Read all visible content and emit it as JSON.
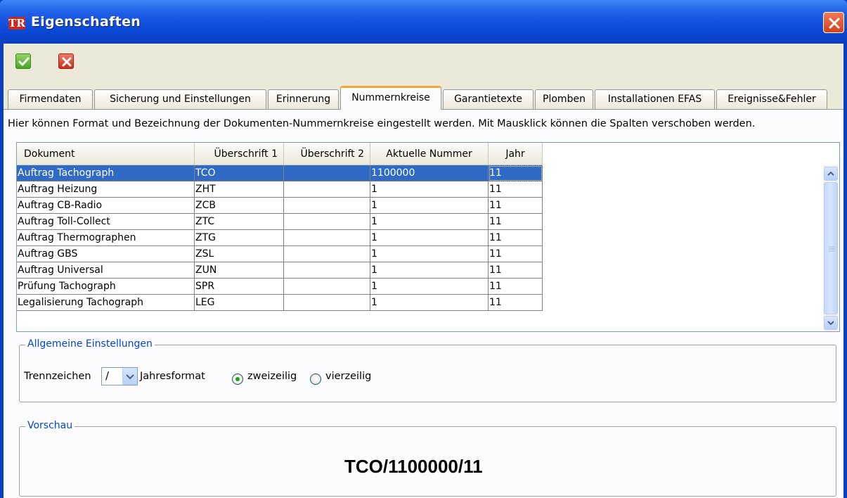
{
  "window": {
    "title": "Eigenschaften",
    "app_icon": "TR"
  },
  "toolbar": {
    "ok_icon": "check-icon",
    "cancel_icon": "x-icon"
  },
  "tabs": [
    {
      "label": "Firmendaten"
    },
    {
      "label": "Sicherung und Einstellungen"
    },
    {
      "label": "Erinnerung"
    },
    {
      "label": "Nummernkreise"
    },
    {
      "label": "Garantietexte"
    },
    {
      "label": "Plomben"
    },
    {
      "label": "Installationen EFAS"
    },
    {
      "label": "Ereignisse&Fehler"
    }
  ],
  "active_tab": "Nummernkreise",
  "hint": "Hier können Format und Bezeichnung der Dokumenten-Nummernkreise eingestellt werden. Mit Mausklick können die Spalten verschoben werden.",
  "table": {
    "headers": [
      "Dokument",
      "Überschrift 1",
      "Überschrift 2",
      "Aktuelle Nummer",
      "Jahr"
    ],
    "rows": [
      {
        "dokument": "Auftrag Tachograph",
        "ue1": "TCO",
        "ue2": "",
        "nummer": "1100000",
        "jahr": "11"
      },
      {
        "dokument": "Auftrag Heizung",
        "ue1": "ZHT",
        "ue2": "",
        "nummer": "1",
        "jahr": "11"
      },
      {
        "dokument": "Auftrag CB-Radio",
        "ue1": "ZCB",
        "ue2": "",
        "nummer": "1",
        "jahr": "11"
      },
      {
        "dokument": "Auftrag Toll-Collect",
        "ue1": "ZTC",
        "ue2": "",
        "nummer": "1",
        "jahr": "11"
      },
      {
        "dokument": "Auftrag Thermographen",
        "ue1": "ZTG",
        "ue2": "",
        "nummer": "1",
        "jahr": "11"
      },
      {
        "dokument": "Auftrag GBS",
        "ue1": "ZSL",
        "ue2": "",
        "nummer": "1",
        "jahr": "11"
      },
      {
        "dokument": "Auftrag Universal",
        "ue1": "ZUN",
        "ue2": "",
        "nummer": "1",
        "jahr": "11"
      },
      {
        "dokument": "Prüfung Tachograph",
        "ue1": "SPR",
        "ue2": "",
        "nummer": "1",
        "jahr": "11"
      },
      {
        "dokument": "Legalisierung Tachograph",
        "ue1": "LEG",
        "ue2": "",
        "nummer": "1",
        "jahr": "11"
      }
    ],
    "selected_row": 0
  },
  "general": {
    "title": "Allgemeine Einstellungen",
    "separator_label": "Trennzeichen",
    "separator_value": "/",
    "year_format_label": "Jahresformat",
    "option_two": "zweizeilig",
    "option_four": "vierzeilig",
    "selected_option": "zweizeilig"
  },
  "preview": {
    "title": "Vorschau",
    "value": "TCO/1100000/11"
  },
  "colors": {
    "accent": "#0046d5",
    "selection": "#316ac5",
    "titlebar": "#0a48d6",
    "tab_highlight": "#f7a632"
  }
}
